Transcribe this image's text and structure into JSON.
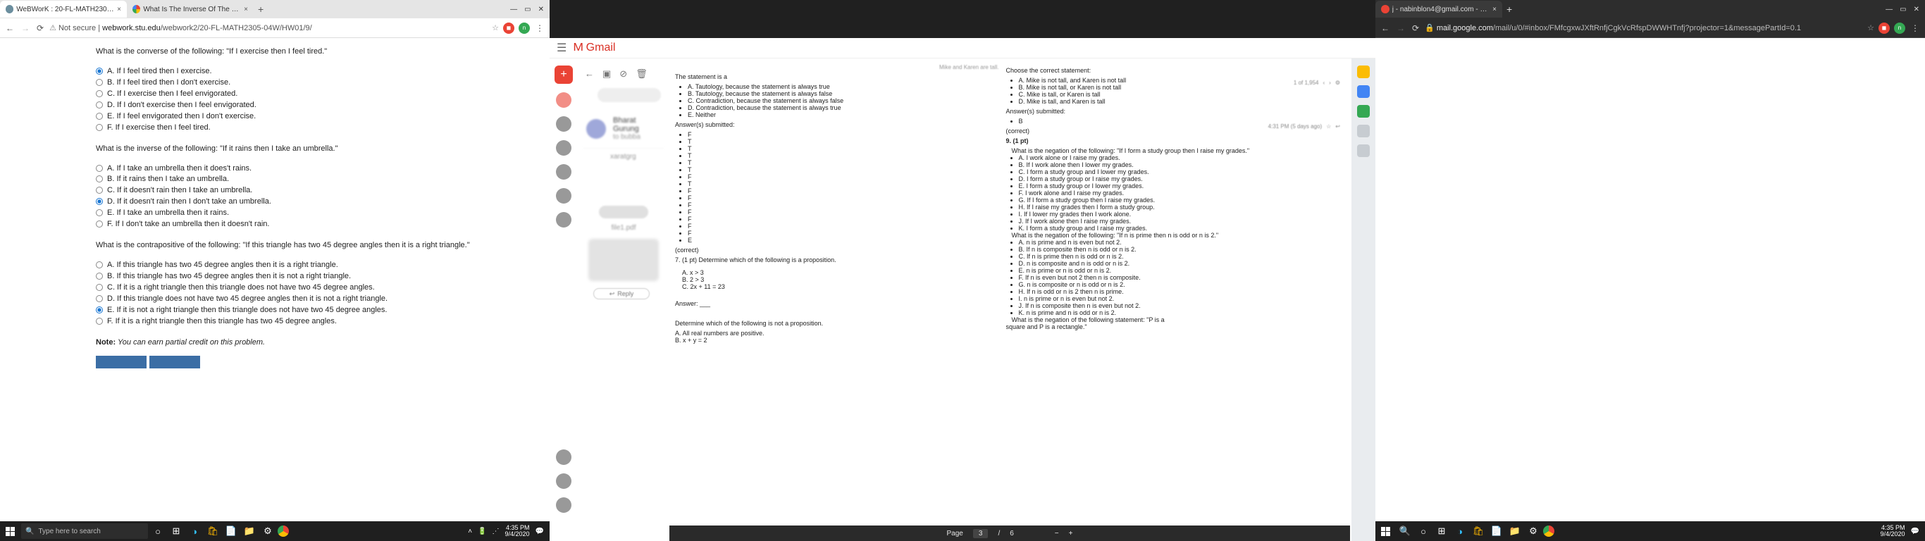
{
  "left": {
    "tabs": [
      {
        "title": "WeBWorK : 20-FL-MATH2305-04"
      },
      {
        "title": "What Is The Inverse Of The Follo"
      }
    ],
    "url_prefix": "Not secure | ",
    "url_host": "webwork.stu.edu",
    "url_path": "/webwork2/20-FL-MATH2305-04W/HW01/9/",
    "q1": "What is the converse of the following: \"If I exercise then I feel tired.\"",
    "q1_opts": [
      "A. If I feel tired then I exercise.",
      "B. If I feel tired then I don't exercise.",
      "C. If I exercise then I feel envigorated.",
      "D. If I don't exercise then I feel envigorated.",
      "E. If I feel envigorated then I don't exercise.",
      "F. If I exercise then I feel tired."
    ],
    "q2": "What is the inverse of the following: \"If it rains then I take an umbrella.\"",
    "q2_opts": [
      "A. If I take an umbrella then it does't rains.",
      "B. If it rains then I take an umbrella.",
      "C. If it doesn't rain then I take an umbrella.",
      "D. If it doesn't rain then I don't take an umbrella.",
      "E. If I take an umbrella then it rains.",
      "F. If I don't take an umbrella then it doesn't rain."
    ],
    "q3": "What is the contrapositive of the following: \"If this triangle has two 45 degree angles then it is a right triangle.\"",
    "q3_opts": [
      "A. If this triangle has two 45 degree angles then it is a right triangle.",
      "B. If this triangle has two 45 degree angles then it is not a right triangle.",
      "C. If it is a right triangle then this triangle does not have two 45 degree angles.",
      "D. If this triangle does not have two 45 degree angles then it is not a right triangle.",
      "E. If it is not a right triangle then this triangle does not have two 45 degree angles.",
      "F. If it is a right triangle then this triangle has two 45 degree angles."
    ],
    "note_b": "Note:",
    "note_i": " You can earn partial credit on this problem."
  },
  "right": {
    "tab_title": "j - nabinblon4@gmail.com - Gm",
    "url_host": "mail.google.com",
    "url_path": "/mail/u/0/#inbox/FMfcgxwJXftRnfjCgkVcRfspDWWHTnfj?projector=1&messagePartId=0.1"
  },
  "gmail": {
    "logo": "Gmail",
    "sender": "Bharat Gurung",
    "to": "to bubba",
    "below": "xaratgrg",
    "attach": "file1.pdf",
    "reply": "Reply",
    "meta1": "1 of 1,954",
    "meta2": "4:31 PM (5 days ago)"
  },
  "preview": {
    "hdr0": "Mike and Karen are tall.",
    "l_title": "The statement is a",
    "l_opts": [
      "A. Tautology, because the statement is always true",
      "B. Tautology, because the statement is always false",
      "C. Contradiction, because the statement is always false",
      "D. Contradiction, because the statement is always true",
      "E. Neither"
    ],
    "ans_sub": "Answer(s) submitted:",
    "correct": "(correct)",
    "q7": "7. (1 pt) Determine which of the following is a proposition.",
    "q7a": "A. x > 3",
    "q7b": "B. 2 > 3",
    "q7c": "C. 2x + 11 = 23",
    "answer": "Answer: ___",
    "det": "Determine which of the following is not a proposition.",
    "detA": "A. All real numbers are positive.",
    "detB": "B. x + y = 2",
    "r_choose": "Choose the correct statement:",
    "r_choose_opts": [
      "A. Mike is not tall, and Karen is not tall",
      "B. Mike is not tall, or Karen is not tall",
      "C. Mike is tall, or Karen is tall",
      "D. Mike is tall, and Karen is tall"
    ],
    "r_bullet_b": "B",
    "q9_hdr": "9. (1 pt)",
    "q9": "What is the negation of the following: \"If I form a study group then I raise my grades.\"",
    "q9_opts": [
      "A. I work alone or I raise my grades.",
      "B. If I work alone then I lower my grades.",
      "C. I form a study group and I lower my grades.",
      "D. I form a study group or I raise my grades.",
      "E. I form a study group or I lower my grades.",
      "F. I work alone and I raise my grades.",
      "G. If I form a study group then I raise my grades.",
      "H. If I raise my grades then I form a study group.",
      "I. If I lower my grades then I work alone.",
      "J. If I work alone then I raise my grades.",
      "K. I form a study group and I raise my grades."
    ],
    "q_neg2": "What is the negation of the following: \"If n is prime then n is odd or n is 2.\"",
    "q_neg2_opts": [
      "A. n is prime and n is even but not 2.",
      "B. If n is composite then n is odd or n is 2.",
      "C. If n is prime then n is odd or n is 2.",
      "D. n is composite and n is odd or n is 2.",
      "E. n is prime or n is odd or n is 2.",
      "F. If n is even but not 2 then n is composite.",
      "G. n is composite or n is odd or n is 2.",
      "H. If n is odd or n is 2 then n is prime.",
      "I. n is prime or n is even but not 2.",
      "J. If n is composite then n is even but not 2.",
      "K. n is prime and n is odd or n is 2."
    ],
    "q_last1": "What is the negation of the following statement: \"P is a",
    "q_last2": "square and P is a rectangle.\""
  },
  "pdf": {
    "page_lbl": "Page",
    "page": "3",
    "sep": "/",
    "total": "6"
  },
  "taskbar": {
    "search": "Type here to search",
    "time": "4:35 PM",
    "date": "9/4/2020"
  }
}
